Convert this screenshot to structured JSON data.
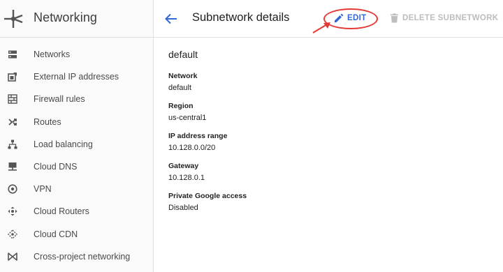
{
  "app": {
    "title": "Networking"
  },
  "sidebar": {
    "items": [
      {
        "label": "Networks",
        "icon": "networks-icon"
      },
      {
        "label": "External IP addresses",
        "icon": "external-ip-icon"
      },
      {
        "label": "Firewall rules",
        "icon": "firewall-icon"
      },
      {
        "label": "Routes",
        "icon": "routes-icon"
      },
      {
        "label": "Load balancing",
        "icon": "load-balancing-icon"
      },
      {
        "label": "Cloud DNS",
        "icon": "cloud-dns-icon"
      },
      {
        "label": "VPN",
        "icon": "vpn-icon"
      },
      {
        "label": "Cloud Routers",
        "icon": "cloud-routers-icon"
      },
      {
        "label": "Cloud CDN",
        "icon": "cloud-cdn-icon"
      },
      {
        "label": "Cross-project networking",
        "icon": "cross-project-icon"
      }
    ]
  },
  "header": {
    "title": "Subnetwork details",
    "edit_label": "EDIT",
    "delete_label": "DELETE SUBNETWORK"
  },
  "subnet": {
    "name": "default",
    "fields": [
      {
        "label": "Network",
        "value": "default"
      },
      {
        "label": "Region",
        "value": "us-central1"
      },
      {
        "label": "IP address range",
        "value": "10.128.0.0/20"
      },
      {
        "label": "Gateway",
        "value": "10.128.0.1"
      },
      {
        "label": "Private Google access",
        "value": "Disabled"
      }
    ]
  },
  "colors": {
    "accent": "#3367d6",
    "annotation": "#e53935",
    "disabled": "#bdbdbd",
    "icon": "#555555"
  }
}
